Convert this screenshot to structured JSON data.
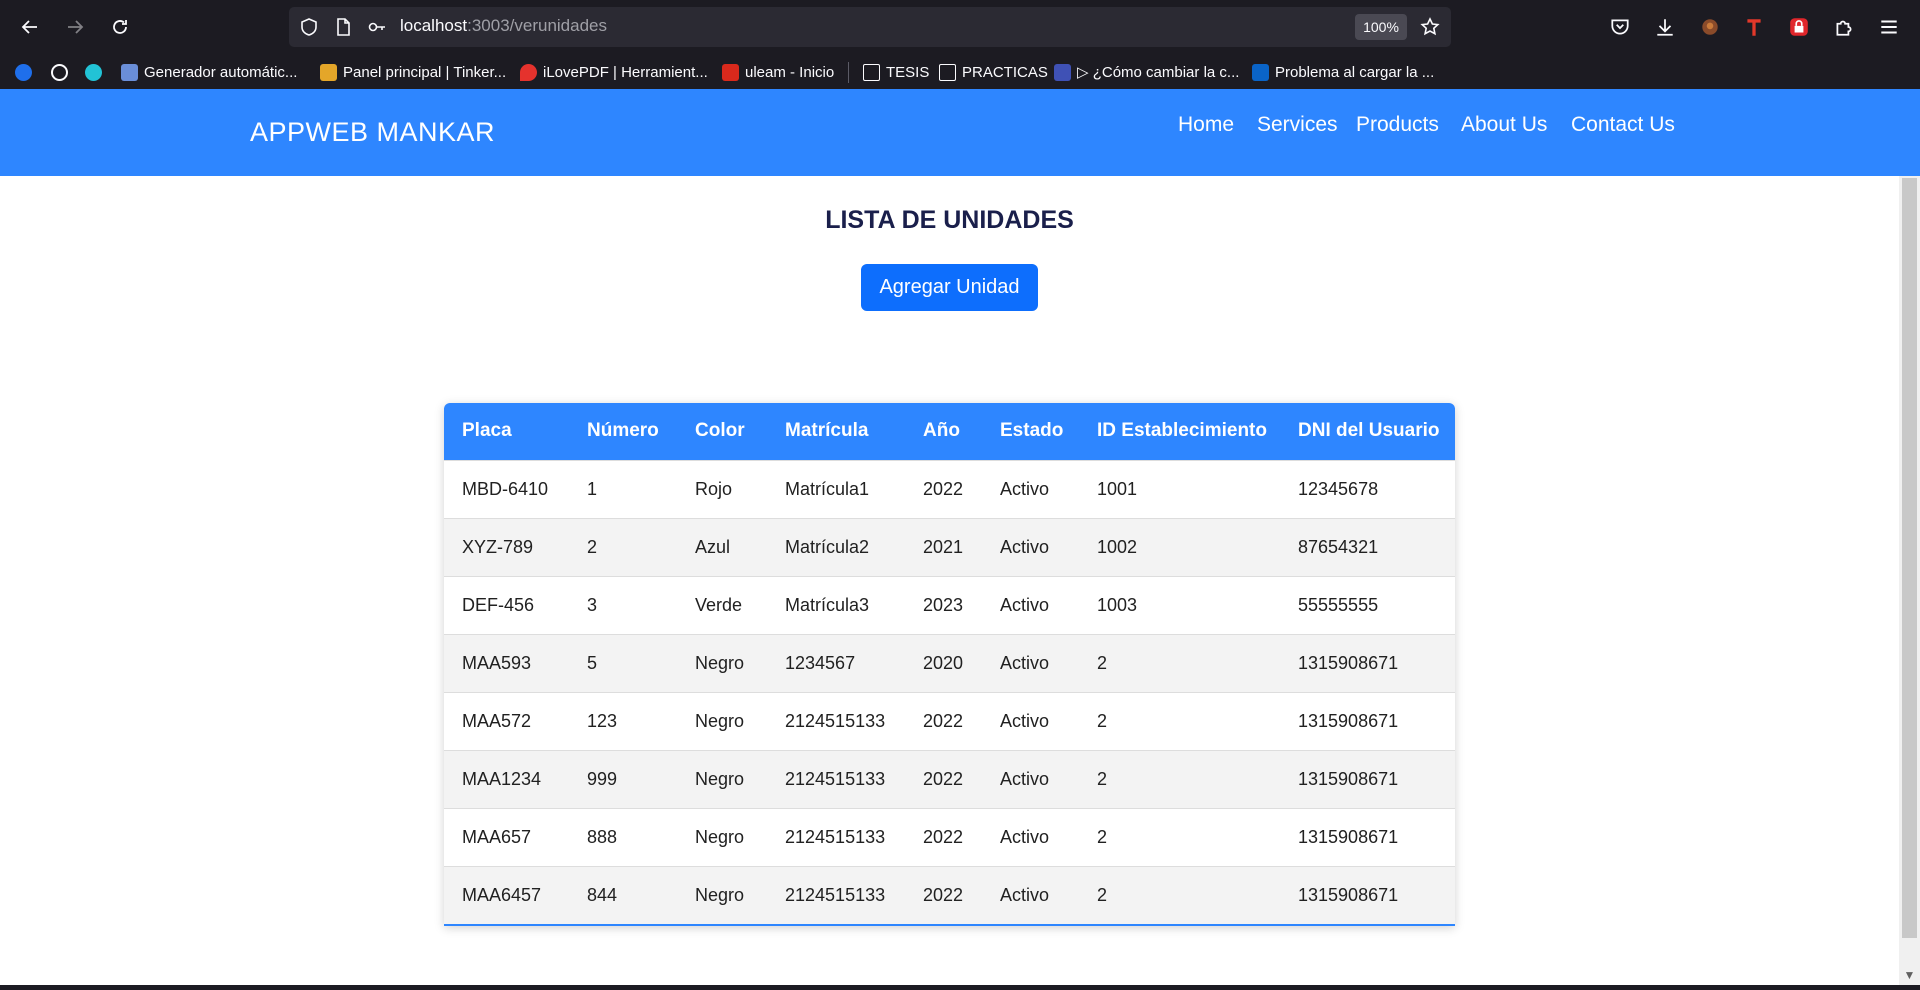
{
  "browser": {
    "url_host": "localhost",
    "url_path": ":3003/verunidades",
    "zoom": "100%",
    "icons": [
      "back-icon",
      "forward-icon",
      "reload-icon",
      "shield-icon",
      "page-icon",
      "key-icon",
      "star-icon",
      "pocket-icon",
      "download-icon",
      "extension-icon",
      "text-icon",
      "lock-extension-icon",
      "puzzle-icon",
      "menu-icon"
    ]
  },
  "bookmarks": [
    {
      "label": "",
      "color": "#1f6feb"
    },
    {
      "label": "",
      "color": "#fbfbfe"
    },
    {
      "label": "",
      "color": "#22c3d6"
    },
    {
      "label": "Generador automátic...",
      "color": "#6a8ed8"
    },
    {
      "label": "Panel principal | Tinker...",
      "color": "#e4a629"
    },
    {
      "label": "iLovePDF | Herramient...",
      "color": "#e5322d"
    },
    {
      "label": "uleam - Inicio",
      "color": "#d9291c"
    },
    {
      "label": "TESIS",
      "color": "folder"
    },
    {
      "label": "PRACTICAS",
      "color": "folder"
    },
    {
      "label": "▷ ¿Cómo cambiar la c...",
      "color": "#3f51b5"
    },
    {
      "label": "Problema al cargar la ...",
      "color": "#0a64c8"
    }
  ],
  "site": {
    "brand": "APPWEB MANKAR",
    "menu": [
      "Home",
      "Services",
      "Products",
      "About Us",
      "Contact Us"
    ],
    "accent": "#2e86ff"
  },
  "main": {
    "title": "LISTA DE UNIDADES",
    "add_button": "Agregar Unidad",
    "table": {
      "headers": [
        "Placa",
        "Número",
        "Color",
        "Matrícula",
        "Año",
        "Estado",
        "ID Establecimiento",
        "DNI del Usuario"
      ],
      "rows": [
        [
          "MBD-6410",
          "1",
          "Rojo",
          "Matrícula1",
          "2022",
          "Activo",
          "1001",
          "12345678"
        ],
        [
          "XYZ-789",
          "2",
          "Azul",
          "Matrícula2",
          "2021",
          "Activo",
          "1002",
          "87654321"
        ],
        [
          "DEF-456",
          "3",
          "Verde",
          "Matrícula3",
          "2023",
          "Activo",
          "1003",
          "55555555"
        ],
        [
          "MAA593",
          "5",
          "Negro",
          "1234567",
          "2020",
          "Activo",
          "2",
          "1315908671"
        ],
        [
          "MAA572",
          "123",
          "Negro",
          "2124515133",
          "2022",
          "Activo",
          "2",
          "1315908671"
        ],
        [
          "MAA1234",
          "999",
          "Negro",
          "2124515133",
          "2022",
          "Activo",
          "2",
          "1315908671"
        ],
        [
          "MAA657",
          "888",
          "Negro",
          "2124515133",
          "2022",
          "Activo",
          "2",
          "1315908671"
        ],
        [
          "MAA6457",
          "844",
          "Negro",
          "2124515133",
          "2022",
          "Activo",
          "2",
          "1315908671"
        ]
      ]
    }
  }
}
